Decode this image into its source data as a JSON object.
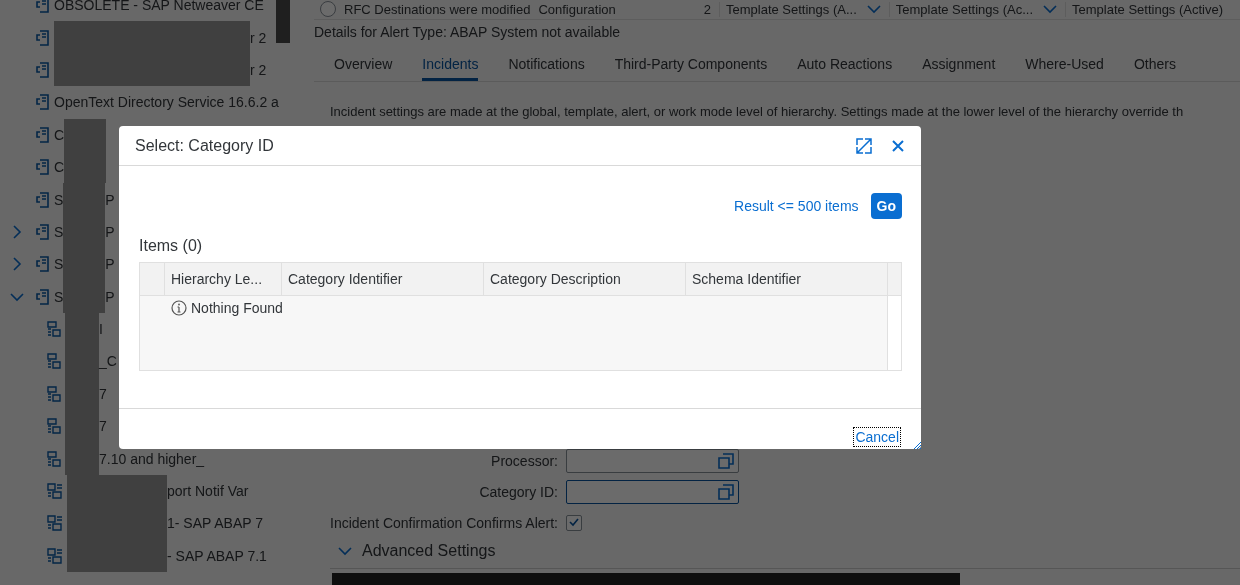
{
  "sidebar": {
    "items": [
      {
        "kind": "document",
        "text": "OBSOLETE - SAP Netweaver CE"
      },
      {
        "kind": "document",
        "redacted": true,
        "after": "r 2"
      },
      {
        "kind": "document",
        "redacted": true,
        "after": "r 2"
      },
      {
        "kind": "document",
        "text": "OpenText Directory Service 16.6.2 a"
      },
      {
        "kind": "document",
        "text": "C",
        "redacted": true
      },
      {
        "kind": "document",
        "text": "C",
        "redacted": true
      },
      {
        "kind": "document",
        "text": "S",
        "redacted": true,
        "after": "P"
      },
      {
        "kind": "document",
        "expanded": false,
        "text": "S",
        "redacted": true,
        "after": "P"
      },
      {
        "kind": "document",
        "expanded": false,
        "text": "S",
        "redacted": true,
        "after": "P"
      },
      {
        "kind": "document",
        "expanded": true,
        "text": "S",
        "redacted": true,
        "after": "P",
        "children": [
          {
            "kind": "list",
            "redacted": true,
            "after": "I"
          },
          {
            "kind": "list",
            "redacted": true,
            "after": "_C"
          },
          {
            "kind": "list",
            "redacted": true,
            "after": "7"
          },
          {
            "kind": "list",
            "redacted": true,
            "after": "7"
          },
          {
            "kind": "list",
            "redacted": true,
            "after": "7.10 and higher_"
          },
          {
            "kind": "report",
            "redacted": true,
            "after": "port Notif Var"
          },
          {
            "kind": "report",
            "redacted": true,
            "after": "1- SAP ABAP 7"
          },
          {
            "kind": "report",
            "redacted": true,
            "after": "- SAP ABAP 7.1"
          }
        ]
      }
    ]
  },
  "top_row": {
    "selected": false,
    "cells": [
      "RFC Destinations were modified",
      "Configuration",
      "2"
    ],
    "dropdowns": [
      "Template Settings (A...",
      "Template Settings (Ac..."
    ],
    "last": "Template Settings (Active)"
  },
  "details_title": "Details for Alert Type: ABAP System not available",
  "tabs": [
    {
      "label": "Overview",
      "selected": false
    },
    {
      "label": "Incidents",
      "selected": true
    },
    {
      "label": "Notifications",
      "selected": false
    },
    {
      "label": "Third-Party Components",
      "selected": false
    },
    {
      "label": "Auto Reactions",
      "selected": false
    },
    {
      "label": "Assignment",
      "selected": false
    },
    {
      "label": "Where-Used",
      "selected": false
    },
    {
      "label": "Others",
      "selected": false
    }
  ],
  "description": "Incident settings are made at the global, template, alert, or work mode level of hierarchy. Settings made at the lower level of the hierarchy override th",
  "form": {
    "fields": [
      {
        "label": "Processor:",
        "focused": false
      },
      {
        "label": "Category ID:",
        "focused": true
      }
    ],
    "confirm": {
      "label": "Incident Confirmation Confirms Alert:",
      "checked": true
    },
    "advanced": {
      "label": "Advanced Settings",
      "expanded": true
    }
  },
  "dialog": {
    "title": "Select: Category ID",
    "result_link": "Result <= 500 items",
    "go": "Go",
    "items_title": "Items (0)",
    "columns": [
      "Hierarchy Le...",
      "Category Identifier",
      "Category Description",
      "Schema Identifier"
    ],
    "empty": "Nothing Found",
    "cancel": "Cancel"
  }
}
